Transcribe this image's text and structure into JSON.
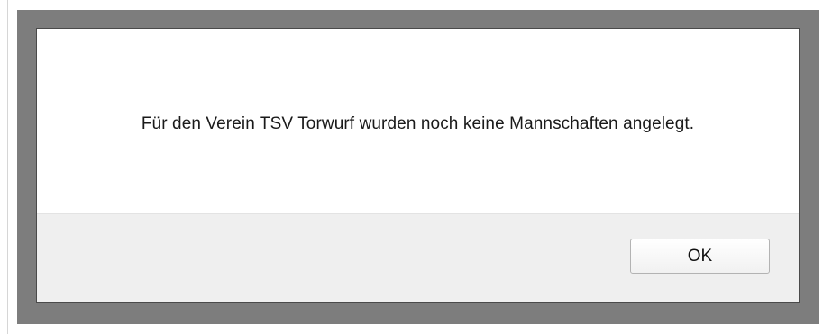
{
  "dialog": {
    "message": "Für den Verein TSV Torwurf wurden noch keine Mannschaften angelegt.",
    "ok_label": "OK"
  }
}
